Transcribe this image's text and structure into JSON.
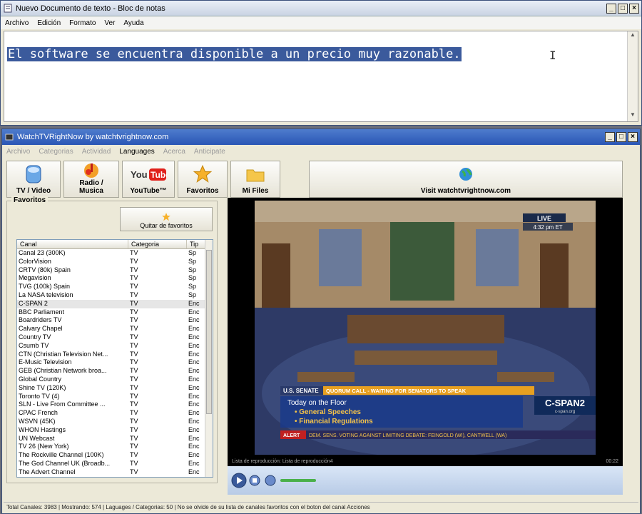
{
  "notepad": {
    "title": "Nuevo Documento de texto - Bloc de notas",
    "menu": [
      "Archivo",
      "Edición",
      "Formato",
      "Ver",
      "Ayuda"
    ],
    "content": "El software se encuentra disponible a un precio muy razonable."
  },
  "app": {
    "title": "WatchTVRightNow by watchtvrightnow.com",
    "menu": [
      "Archivo",
      "Categorias",
      "Actividad",
      "Languages",
      "Acerca",
      "Anticipate"
    ],
    "toolbar": {
      "tv": "TV / Video",
      "radio": "Radio / Musica",
      "youtube": "YouTube™",
      "favoritos": "Favoritos",
      "mifiles": "Mi Files",
      "visit": "Visit watchtvrightnow.com"
    },
    "favorites_legend": "Favoritos",
    "quitar": "Quitar de favoritos",
    "list_headers": [
      "Canal",
      "Categoria",
      "Tip"
    ],
    "channels": [
      [
        "Canal 23 (300K)",
        "TV",
        "Sp"
      ],
      [
        "ColorVision",
        "TV",
        "Sp"
      ],
      [
        "CRTV (80k) Spain",
        "TV",
        "Sp"
      ],
      [
        "Megavision",
        "TV",
        "Sp"
      ],
      [
        "TVG (100k) Spain",
        "TV",
        "Sp"
      ],
      [
        "La NASA television",
        "TV",
        "Sp"
      ],
      [
        "C-SPAN 2",
        "TV",
        "Enc"
      ],
      [
        "BBC Parliament",
        "TV",
        "Enc"
      ],
      [
        "Boardriders TV",
        "TV",
        "Enc"
      ],
      [
        "Calvary Chapel",
        "TV",
        "Enc"
      ],
      [
        "Country TV",
        "TV",
        "Enc"
      ],
      [
        "Csumb TV",
        "TV",
        "Enc"
      ],
      [
        "CTN (Christian Television Net...",
        "TV",
        "Enc"
      ],
      [
        "E-Music Television",
        "TV",
        "Enc"
      ],
      [
        "GEB (Christian Network broa...",
        "TV",
        "Enc"
      ],
      [
        "Global Country",
        "TV",
        "Enc"
      ],
      [
        "Shine TV (120K)",
        "TV",
        "Enc"
      ],
      [
        "Toronto TV (4)",
        "TV",
        "Enc"
      ],
      [
        "SLN - Live From Committee ...",
        "TV",
        "Enc"
      ],
      [
        "CPAC French",
        "TV",
        "Enc"
      ],
      [
        "WSVN (45K)",
        "TV",
        "Enc"
      ],
      [
        "WHON Hastings",
        "TV",
        "Enc"
      ],
      [
        "UN Webcast",
        "TV",
        "Enc"
      ],
      [
        "TV 26 (New York)",
        "TV",
        "Enc"
      ],
      [
        "The Rockville Channel (100K)",
        "TV",
        "Enc"
      ],
      [
        "The God Channel UK (Broadb...",
        "TV",
        "Enc"
      ],
      [
        "The Advert Channel",
        "TV",
        "Enc"
      ]
    ],
    "video": {
      "live": "LIVE",
      "clock": "4:32 pm ET",
      "senate": "U.S. SENATE",
      "quorum": "QUORUM CALL - WAITING FOR SENATORS TO SPEAK",
      "today": "Today on the Floor",
      "b1": "• General Speeches",
      "b2": "• Financial Regulations",
      "alert": "ALERT",
      "ticker": "DEM. SENS. VOTING AGAINST LIMITING DEBATE: FEINGOLD (WI), CANTWELL (WA)",
      "cspan": "C-SPAN2",
      "cspan_url": "c-span.org",
      "status_left": "Lista de reproducción: Lista de reproducción4",
      "status_right": "00:22"
    },
    "statusbar": "Total Canales: 3983 | Mostrando: 574 | Laguages / Categorias: 50 | No se olvide de su lista de canales favoritos con el boton del canal Acciones"
  }
}
